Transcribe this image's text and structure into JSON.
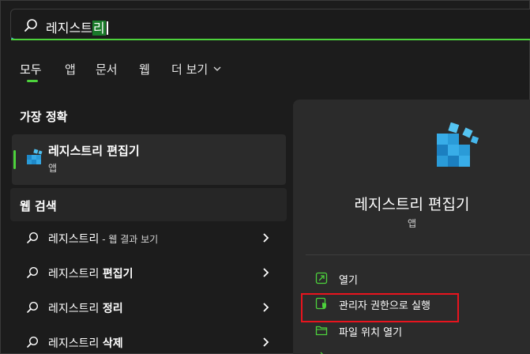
{
  "search": {
    "query_prefix": "레지스트",
    "query_selected": "리"
  },
  "tabs": [
    {
      "label": "모두"
    },
    {
      "label": "앱"
    },
    {
      "label": "문서"
    },
    {
      "label": "웹"
    },
    {
      "label": "더 보기"
    }
  ],
  "best_match": {
    "title": "가장 정확",
    "name": "레지스트리 편집기",
    "type": "앱"
  },
  "web_search": {
    "title": "웹 검색",
    "items": [
      {
        "prefix": "레지스트리",
        "bold": "",
        "suffix": " - 웹 결과 보기"
      },
      {
        "prefix": "레지스트리 ",
        "bold": "편집기",
        "suffix": ""
      },
      {
        "prefix": "레지스트리 ",
        "bold": "정리",
        "suffix": ""
      },
      {
        "prefix": "레지스트리 ",
        "bold": "삭제",
        "suffix": ""
      }
    ]
  },
  "details": {
    "name": "레지스트리 편집기",
    "type": "앱",
    "actions": [
      {
        "label": "열기",
        "icon": "open-icon"
      },
      {
        "label": "관리자 권한으로 실행",
        "icon": "shield-icon"
      },
      {
        "label": "파일 위치 열기",
        "icon": "folder-icon"
      }
    ]
  },
  "colors": {
    "accent": "#4dd23c",
    "icon_blue": "#29a8e0",
    "highlight_red": "#e8141e"
  }
}
